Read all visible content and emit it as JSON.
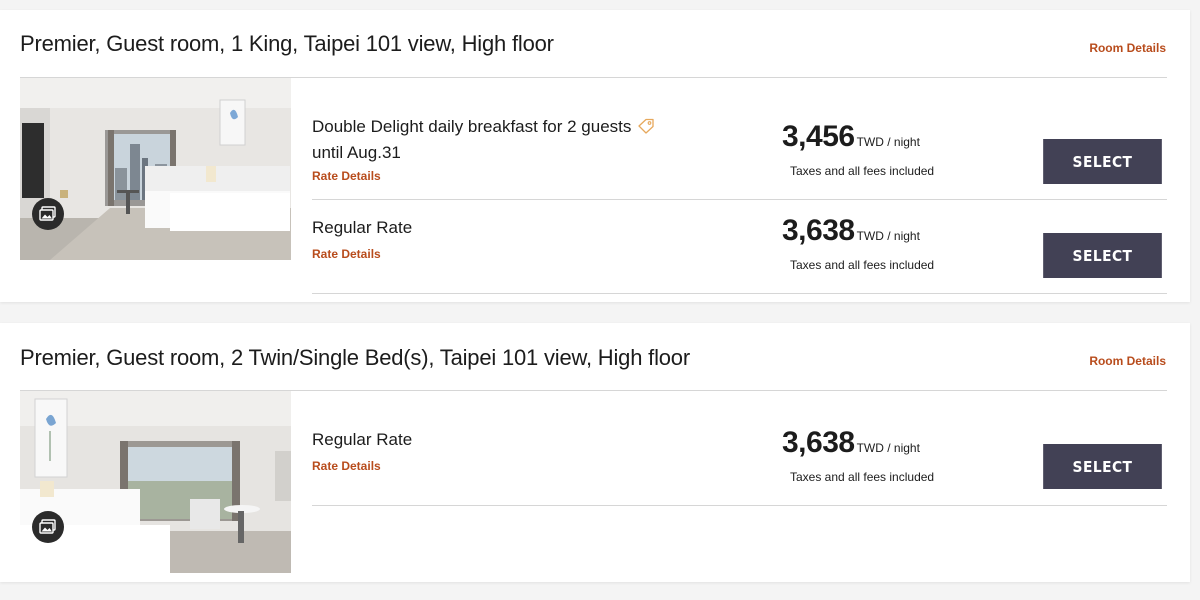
{
  "rooms": [
    {
      "title": "Premier, Guest room, 1 King, Taipei 101 view, High floor",
      "room_details_label": "Room Details",
      "rates": [
        {
          "name_line1": "Double Delight daily breakfast for 2 guests",
          "name_line2": "until Aug.31",
          "rate_details_label": "Rate Details",
          "price": "3,456",
          "unit": "TWD / night",
          "note": "Taxes and all fees included",
          "select_label": "SELECT",
          "promo_icon": "tag-icon"
        },
        {
          "name_line1": "Regular Rate",
          "rate_details_label": "Rate Details",
          "price": "3,638",
          "unit": "TWD / night",
          "note": "Taxes and all fees included",
          "select_label": "SELECT"
        }
      ]
    },
    {
      "title": "Premier, Guest room, 2 Twin/Single Bed(s), Taipei 101 view, High floor",
      "room_details_label": "Room Details",
      "rates": [
        {
          "name_line1": "Regular Rate",
          "rate_details_label": "Rate Details",
          "price": "3,638",
          "unit": "TWD / night",
          "note": "Taxes and all fees included",
          "select_label": "SELECT"
        }
      ]
    }
  ],
  "colors": {
    "accent": "#b84c1c",
    "button": "#424155",
    "background": "#f4f4f4"
  }
}
